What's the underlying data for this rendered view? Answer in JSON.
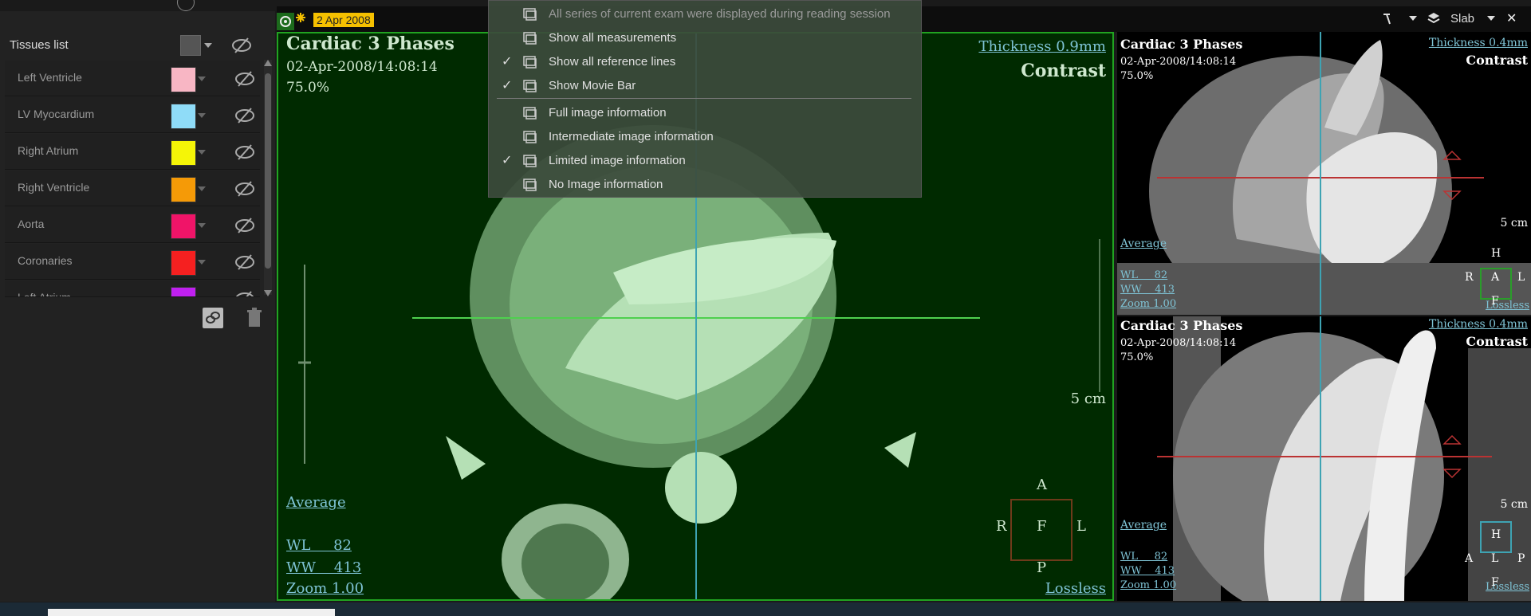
{
  "left": {
    "tissues_title": "Tissues list",
    "tissues": [
      {
        "label": "Left Ventricle",
        "color": "#f8b6c4"
      },
      {
        "label": "LV Myocardium",
        "color": "#8fdcf8"
      },
      {
        "label": "Right Atrium",
        "color": "#f5f507"
      },
      {
        "label": "Right Ventricle",
        "color": "#f59a07"
      },
      {
        "label": "Aorta",
        "color": "#f01468"
      },
      {
        "label": "Coronaries",
        "color": "#f52020"
      },
      {
        "label": "Left Atrium",
        "color": "#c020f0"
      }
    ]
  },
  "tab": {
    "date": "2 Apr 2008"
  },
  "toolbar": {
    "slab_label": "Slab",
    "close": "✕"
  },
  "menu": {
    "items": [
      {
        "label": "All series of current exam were displayed during reading session",
        "checked": false,
        "disabled": true,
        "icon": "monitor-icon"
      },
      {
        "label": "Show all measurements",
        "checked": false,
        "disabled": false,
        "icon": "measurement-icon"
      },
      {
        "label": "Show all reference lines",
        "checked": true,
        "disabled": false,
        "icon": "reference-lines-icon"
      },
      {
        "label": "Show Movie Bar",
        "checked": true,
        "disabled": false,
        "icon": "movie-bar-icon"
      },
      {
        "label": "Full image information",
        "checked": false,
        "disabled": false,
        "icon": "image-info-icon"
      },
      {
        "label": "Intermediate image information",
        "checked": false,
        "disabled": false,
        "icon": "image-info-icon"
      },
      {
        "label": "Limited image information",
        "checked": true,
        "disabled": false,
        "icon": "image-info-icon"
      },
      {
        "label": "No Image information",
        "checked": false,
        "disabled": false,
        "icon": "image-info-icon"
      }
    ]
  },
  "main": {
    "title": "Cardiac 3 Phases",
    "datetime": "02-Apr-2008/14:08:14",
    "percent": "75.0%",
    "thickness": "Thickness 0.9mm",
    "contrast": "Contrast",
    "scale": "5 cm",
    "average": "Average",
    "wl": "WL     82",
    "ww": "WW    413",
    "zoom": "Zoom 1.00",
    "lossless": "Lossless",
    "orient": {
      "top": "A",
      "left": "R",
      "center": "F",
      "right": "L",
      "bottom": "P"
    }
  },
  "side_top": {
    "title": "Cardiac 3 Phases",
    "datetime": "02-Apr-2008/14:08:14",
    "percent": "75.0%",
    "thickness": "Thickness 0.4mm",
    "contrast": "Contrast",
    "scale": "5 cm",
    "average": "Average",
    "wl": "WL     82",
    "ww": "WW    413",
    "zoom": "Zoom 1.00",
    "lossless": "Lossless",
    "orient": {
      "top": "H",
      "left": "R",
      "center": "A",
      "right": "L",
      "bottom": "F"
    }
  },
  "side_bottom": {
    "title": "Cardiac 3 Phases",
    "datetime": "02-Apr-2008/14:08:14",
    "percent": "75.0%",
    "thickness": "Thickness 0.4mm",
    "contrast": "Contrast",
    "scale": "5 cm",
    "average": "Average",
    "wl": "WL     82",
    "ww": "WW    413",
    "zoom": "Zoom 1.00",
    "lossless": "Lossless",
    "orient": {
      "top": "H",
      "left": "A",
      "center": "L",
      "right": "P",
      "bottom": "F"
    }
  }
}
